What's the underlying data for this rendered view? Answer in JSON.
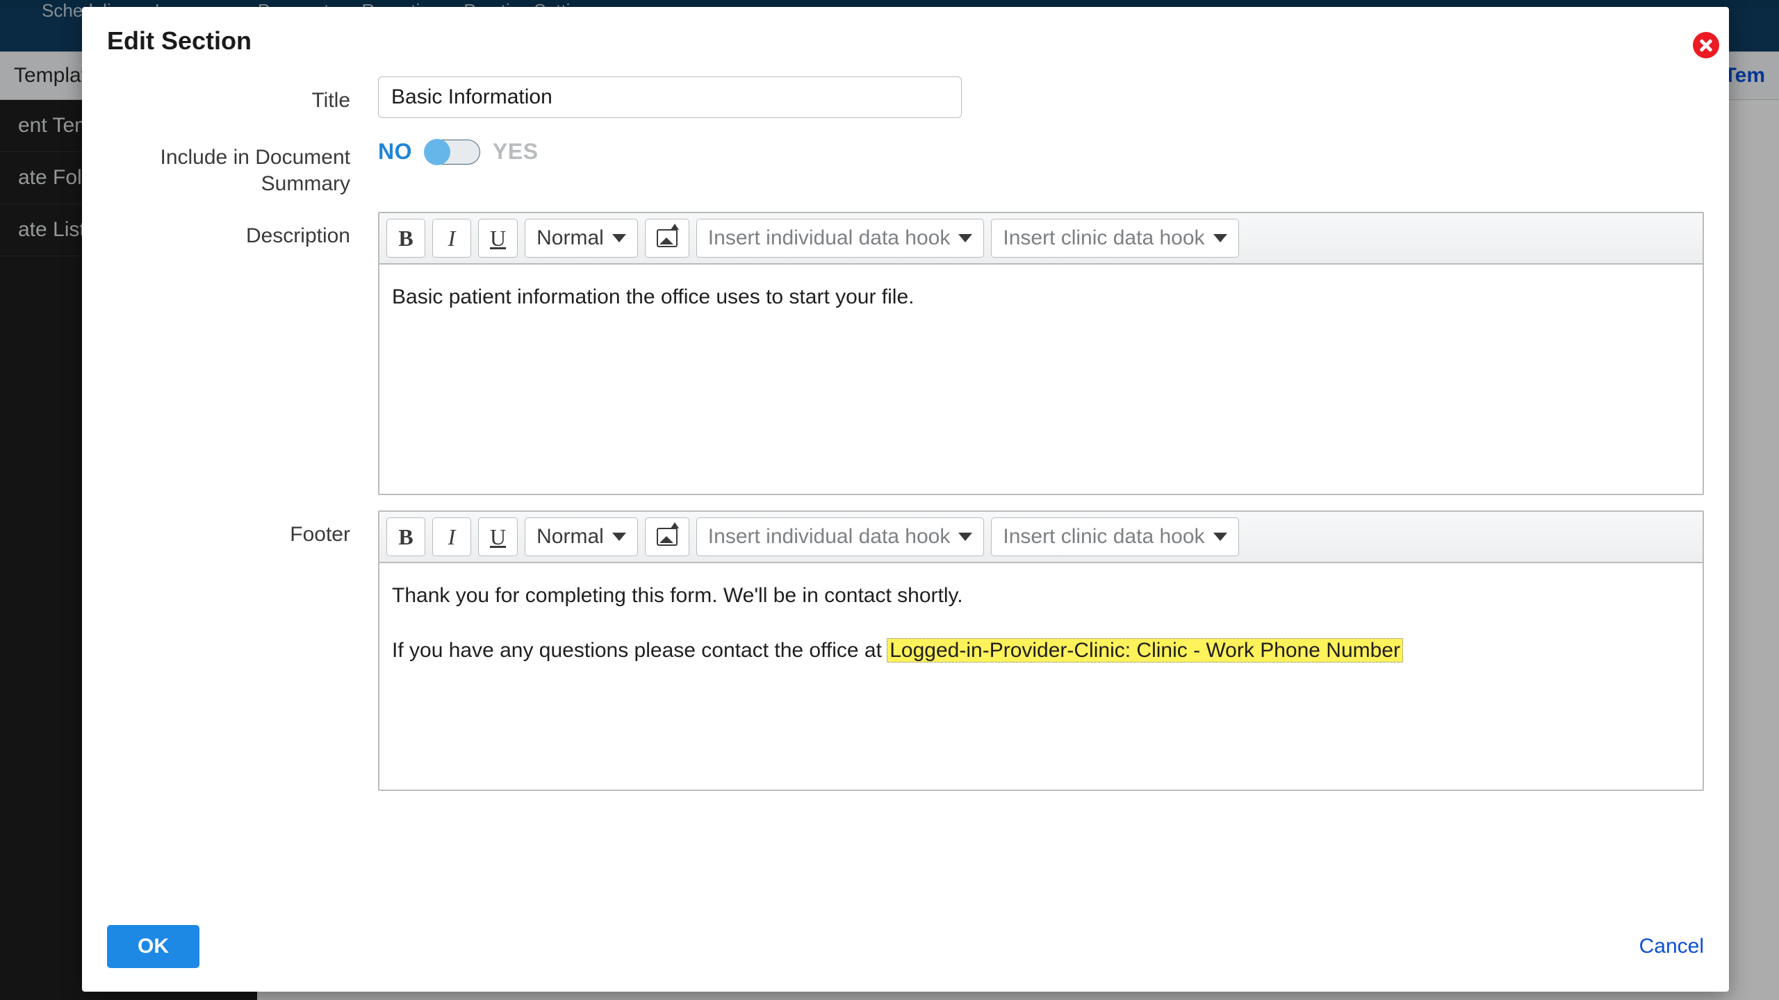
{
  "bg": {
    "nav": [
      "Scheduling",
      "Insurance",
      "Payments",
      "Reporting",
      "Practice Settings"
    ],
    "subbar_left": "Templates",
    "subbar_right": "ck to Tem",
    "sidebar": [
      "ent Temp",
      "ate Folde",
      "ate List"
    ]
  },
  "modal": {
    "title": "Edit Section",
    "labels": {
      "title": "Title",
      "include": "Include in Document Summary",
      "description": "Description",
      "footer": "Footer"
    },
    "title_value": "Basic Information",
    "toggle": {
      "no": "NO",
      "yes": "YES",
      "state": "no"
    },
    "toolbar": {
      "bold": "B",
      "italic": "I",
      "underline": "U",
      "style": "Normal",
      "hook_individual": "Insert individual data hook",
      "hook_clinic": "Insert clinic data hook"
    },
    "description_text": "Basic patient information the office uses to start your file.",
    "footer_line1": "Thank you for completing this form. We'll be in contact shortly.",
    "footer_line2_prefix": "If you have any questions please contact the office at ",
    "footer_hook": "Logged-in-Provider-Clinic: Clinic - Work Phone Number",
    "actions": {
      "ok": "OK",
      "cancel": "Cancel"
    }
  }
}
